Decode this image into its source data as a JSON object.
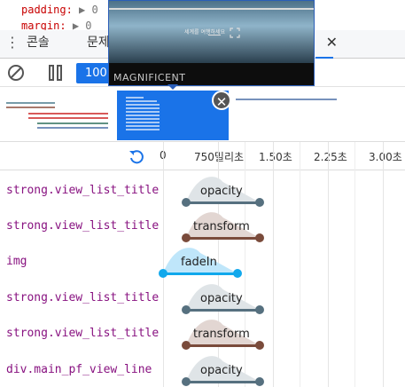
{
  "code_strip": {
    "line1_prop": "padding:",
    "line1_rest": "▶ 0",
    "line2_prop": "margin:",
    "line2_rest": "▶ 0"
  },
  "tabbar": {
    "tabs": [
      "콘솔",
      "문제"
    ],
    "close_glyph": "✕"
  },
  "toolbar": {
    "speed_label": "100"
  },
  "preview": {
    "brand": "MAGNIFICENT",
    "caption": "세계를 여행하세요"
  },
  "timeline": {
    "ticks": [
      "0",
      "750밀리초",
      "1.50초",
      "2.25초",
      "3.00초"
    ]
  },
  "rows": [
    {
      "selector": "strong.view_list_title",
      "animation": "opacity",
      "color": "#56707f"
    },
    {
      "selector": "strong.view_list_title",
      "animation": "transform",
      "color": "#7a4b3b"
    },
    {
      "selector": "img",
      "animation": "fadeIn",
      "color": "#11a8ec"
    },
    {
      "selector": "strong.view_list_title",
      "animation": "opacity",
      "color": "#56707f"
    },
    {
      "selector": "strong.view_list_title",
      "animation": "transform",
      "color": "#7a4b3b"
    },
    {
      "selector": "div.main_pf_view_line",
      "animation": "opacity",
      "color": "#56707f"
    }
  ],
  "colors": {
    "accent": "#1a73e8"
  }
}
